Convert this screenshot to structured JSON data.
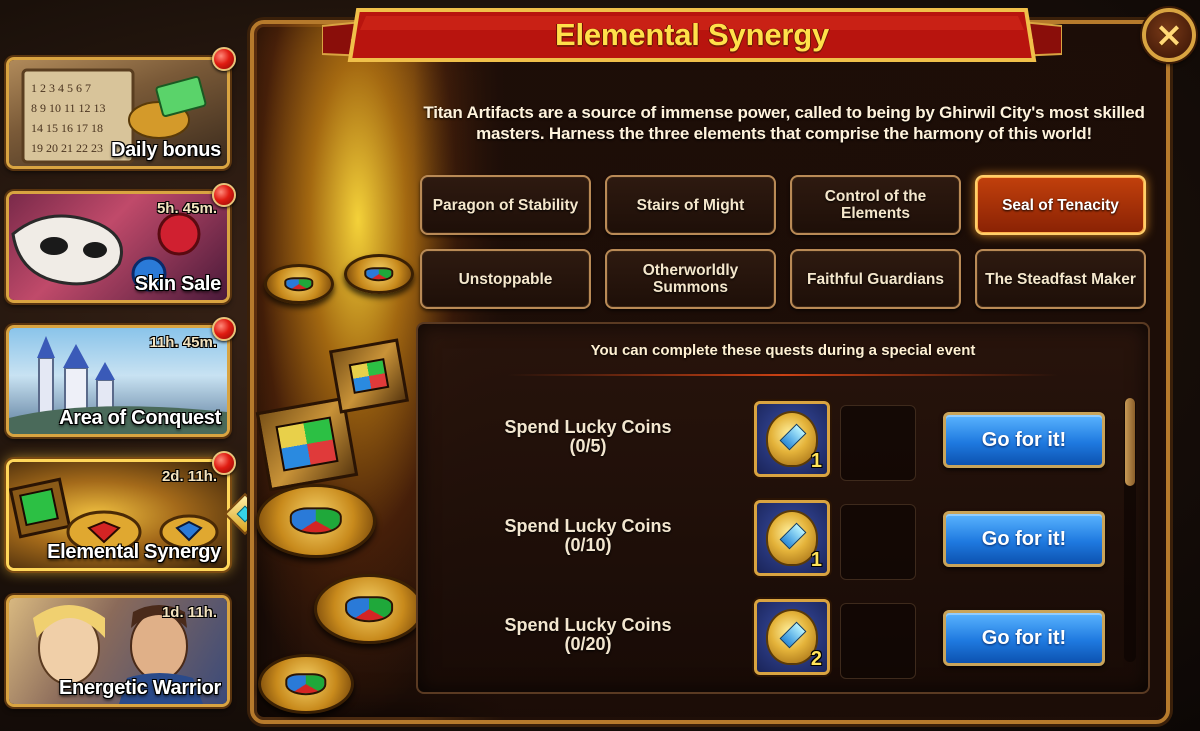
{
  "sidebar": {
    "items": [
      {
        "label": "Daily bonus",
        "timer": "",
        "badge": true
      },
      {
        "label": "Skin Sale",
        "timer": "5h. 45m.",
        "badge": true
      },
      {
        "label": "Area of Conquest",
        "timer": "11h. 45m.",
        "badge": true
      },
      {
        "label": "Elemental Synergy",
        "timer": "2d. 11h.",
        "badge": true,
        "active": true
      },
      {
        "label": "Energetic Warrior",
        "timer": "1d. 11h.",
        "badge": false
      }
    ]
  },
  "panel": {
    "title": "Elemental Synergy",
    "close_icon": "×",
    "description": "Titan Artifacts are a source of immense power, called to being by Ghirwil City's most skilled masters. Harness the three elements that comprise the harmony of this world!",
    "tabs": [
      {
        "label": "Paragon of Stability"
      },
      {
        "label": "Stairs of Might"
      },
      {
        "label": "Control of the Elements"
      },
      {
        "label": "Seal of Tenacity",
        "active": true
      },
      {
        "label": "Unstoppable"
      },
      {
        "label": "Otherworldly Summons"
      },
      {
        "label": "Faithful Guardians"
      },
      {
        "label": "The Steadfast Maker"
      }
    ]
  },
  "quests": {
    "header": "You can complete these quests during a special event",
    "rows": [
      {
        "title": "Spend Lucky Coins",
        "progress": "(0/5)",
        "reward_count": "1",
        "button": "Go for it!"
      },
      {
        "title": "Spend Lucky Coins",
        "progress": "(0/10)",
        "reward_count": "1",
        "button": "Go for it!"
      },
      {
        "title": "Spend Lucky Coins",
        "progress": "(0/20)",
        "reward_count": "2",
        "button": "Go for it!"
      }
    ],
    "scroll_position": 0
  },
  "colors": {
    "accent_gold": "#d9a441",
    "title_yellow": "#ffe04a",
    "active_tab": "#c2400c",
    "button_blue": "#1f7ae0",
    "badge_red": "#e01c12"
  }
}
